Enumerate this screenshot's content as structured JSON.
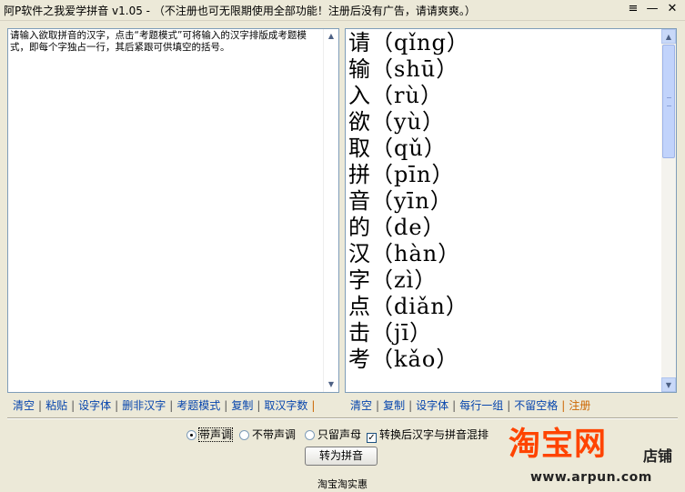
{
  "window": {
    "title": "阿P软件之我爱学拼音 v1.05 - （不注册也可无限期使用全部功能！注册后没有广告，请请爽爽。）",
    "menu_glyph": "≡",
    "minimize_glyph": "—",
    "close_glyph": "✕"
  },
  "input": {
    "text": "请输入欲取拼音的汉字，点击“考题模式”可将输入的汉字排版成考题模式，即每个字独占一行，其后紧跟可供填空的括号。"
  },
  "output": {
    "lines": [
      {
        "char": "请",
        "pinyin": "qǐng"
      },
      {
        "char": "输",
        "pinyin": "shū"
      },
      {
        "char": "入",
        "pinyin": "rù"
      },
      {
        "char": "欲",
        "pinyin": "yù"
      },
      {
        "char": "取",
        "pinyin": "qǔ"
      },
      {
        "char": "拼",
        "pinyin": "pīn"
      },
      {
        "char": "音",
        "pinyin": "yīn"
      },
      {
        "char": "的",
        "pinyin": "de"
      },
      {
        "char": "汉",
        "pinyin": "hàn"
      },
      {
        "char": "字",
        "pinyin": "zì"
      },
      {
        "char": "点",
        "pinyin": "diǎn"
      },
      {
        "char": "击",
        "pinyin": "jī"
      },
      {
        "char": "考",
        "pinyin": "kǎo"
      }
    ]
  },
  "left_links": [
    "清空",
    "粘贴",
    "设字体",
    "删非汉字",
    "考题模式",
    "复制",
    "取汉字数"
  ],
  "right_links": [
    "清空",
    "复制",
    "设字体",
    "每行一组",
    "不留空格"
  ],
  "register_link": "注册",
  "options": {
    "tone": "带声调",
    "no_tone": "不带声调",
    "initials_only": "只留声母",
    "mix_label": "转换后汉字与拼音混排",
    "selected": "tone",
    "mix_checked": true
  },
  "convert_button": "转为拼音",
  "ad": {
    "brand": "淘宝网",
    "shop": "店铺",
    "url": "www.arpun.com"
  },
  "statusbar": "淘宝淘实惠",
  "colors": {
    "link": "#0645ad",
    "register": "#cc6600",
    "brand": "#ff4400"
  }
}
